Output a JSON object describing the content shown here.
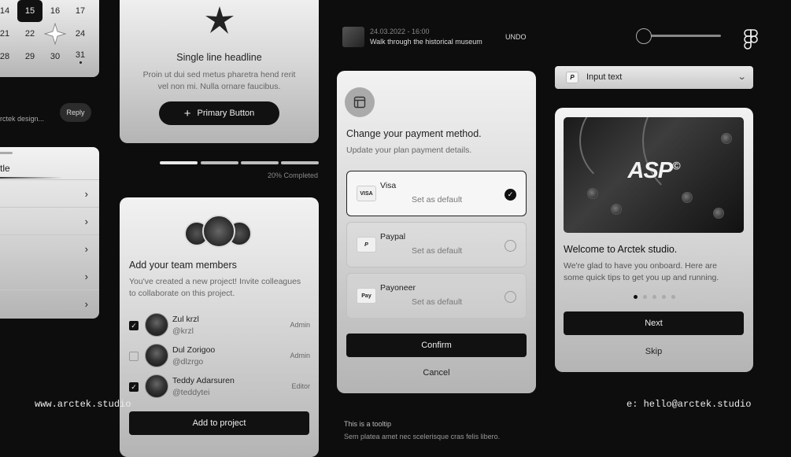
{
  "calendar": {
    "rows": [
      [
        "14",
        "15",
        "16",
        "17"
      ],
      [
        "21",
        "22",
        "",
        "24"
      ],
      [
        "28",
        "29",
        "30",
        "31"
      ]
    ],
    "selected": "15"
  },
  "reply": {
    "preview": "rctek design...",
    "button": "Reply"
  },
  "list": {
    "title": "tle"
  },
  "headline_card": {
    "title": "Single line headline",
    "body_line1": "Proin ut dui sed metus pharetra hend rerit",
    "body_line2": "vel non mi. Nulla ornare faucibus.",
    "button": "Primary Button",
    "button_icon": "+"
  },
  "progress": {
    "value": 0.2,
    "label": "20% Completed"
  },
  "team_card": {
    "title": "Add your team members",
    "desc_line1": "You've created a new project! Invite colleagues",
    "desc_line2": "to collaborate on this project.",
    "members": [
      {
        "name": "Zul krzl",
        "handle": "@krzl",
        "role": "Admin",
        "checked": true
      },
      {
        "name": "Dul Zorigoo",
        "handle": "@dlzrgo",
        "role": "Admin",
        "checked": false
      },
      {
        "name": "Teddy Adarsuren",
        "handle": "@teddytei",
        "role": "Editor",
        "checked": true
      }
    ],
    "button": "Add to project"
  },
  "toast": {
    "time": "24.03.2022 - 16:00",
    "text": "Walk through the historical museum",
    "action": "UNDO"
  },
  "payment_card": {
    "title": "Change your payment method.",
    "subtitle": "Update your plan payment details.",
    "options": [
      {
        "name": "Visa",
        "logo": "VISA",
        "sub": "Set as default",
        "selected": true
      },
      {
        "name": "Paypal",
        "logo": "P",
        "sub": "Set as default",
        "selected": false
      },
      {
        "name": "Payoneer",
        "logo": "Pay",
        "sub": "Set as default",
        "selected": false
      }
    ],
    "confirm": "Confirm",
    "cancel": "Cancel"
  },
  "tooltip": {
    "title": "This is a tooltip",
    "body": "Sem platea amet nec scelerisque cras felis libero."
  },
  "slider": {
    "value": 0.1
  },
  "input": {
    "value": "Input text",
    "icon": "paypal-icon"
  },
  "welcome_card": {
    "hero_text": "ASP",
    "hero_mark": "©",
    "title": "Welcome to Arctek studio.",
    "body_line1": "We're glad to have you onboard. Here are",
    "body_line2": "some quick tips to get you up and running.",
    "dots": 5,
    "active_dot": 0,
    "next": "Next",
    "skip": "Skip"
  },
  "footer": {
    "website": "www.arctek.studio",
    "email": "e: hello@arctek.studio"
  },
  "colors": {
    "background": "#0d0d0d",
    "primary": "#111111",
    "card": "#d8d8d8"
  }
}
